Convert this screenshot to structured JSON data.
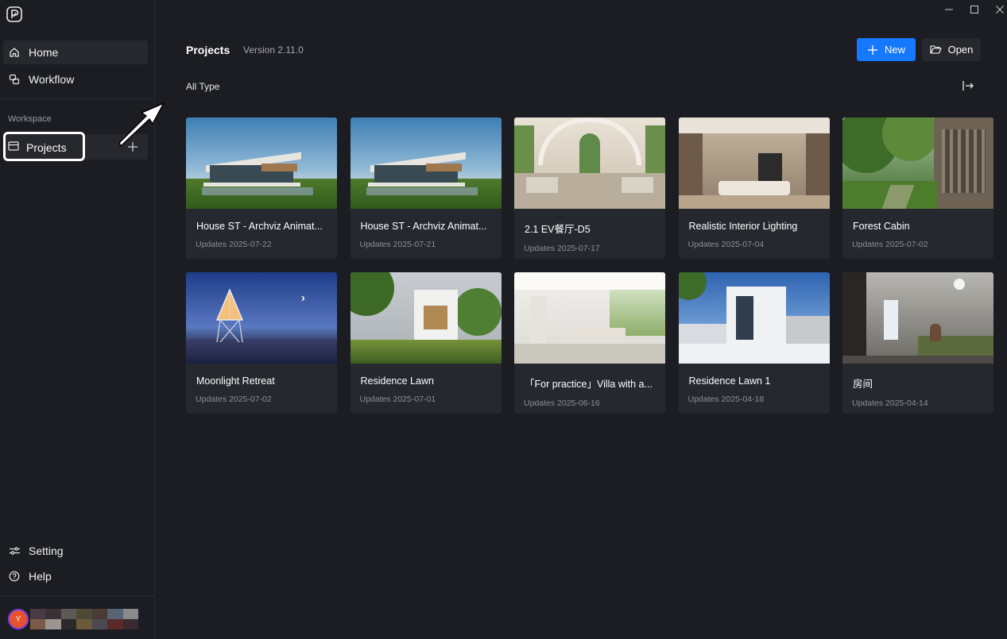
{
  "app": {
    "window_controls": [
      "minimize",
      "maximize",
      "close"
    ]
  },
  "sidebar": {
    "home_label": "Home",
    "workflow_label": "Workflow",
    "workspace_label": "Workspace",
    "projects_label": "Projects",
    "setting_label": "Setting",
    "help_label": "Help",
    "user_initial": "Y"
  },
  "header": {
    "title": "Projects",
    "version": "Version 2.11.0",
    "new_label": "New",
    "open_label": "Open",
    "filter_label": "All Type"
  },
  "projects": [
    {
      "title": "House ST - Archviz Animat...",
      "date": "Updates 2025-07-22"
    },
    {
      "title": "House ST - Archviz Animat...",
      "date": "Updates 2025-07-21"
    },
    {
      "title": "2.1 EV餐厅-D5",
      "date": "Updates 2025-07-17"
    },
    {
      "title": "Realistic Interior Lighting",
      "date": "Updates 2025-07-04"
    },
    {
      "title": "Forest Cabin",
      "date": "Updates 2025-07-02"
    },
    {
      "title": "Moonlight Retreat",
      "date": "Updates 2025-07-02"
    },
    {
      "title": "Residence Lawn",
      "date": "Updates 2025-07-01"
    },
    {
      "title": "「For practice」Villa with a...",
      "date": "Updates 2025-06-16"
    },
    {
      "title": "Residence Lawn 1",
      "date": "Updates 2025-04-18"
    },
    {
      "title": "房间",
      "date": "Updates 2025-04-14"
    }
  ],
  "colors": {
    "accent": "#1677ff",
    "background": "#1c1d22",
    "card": "#262830",
    "avatar": "#e8512c"
  }
}
